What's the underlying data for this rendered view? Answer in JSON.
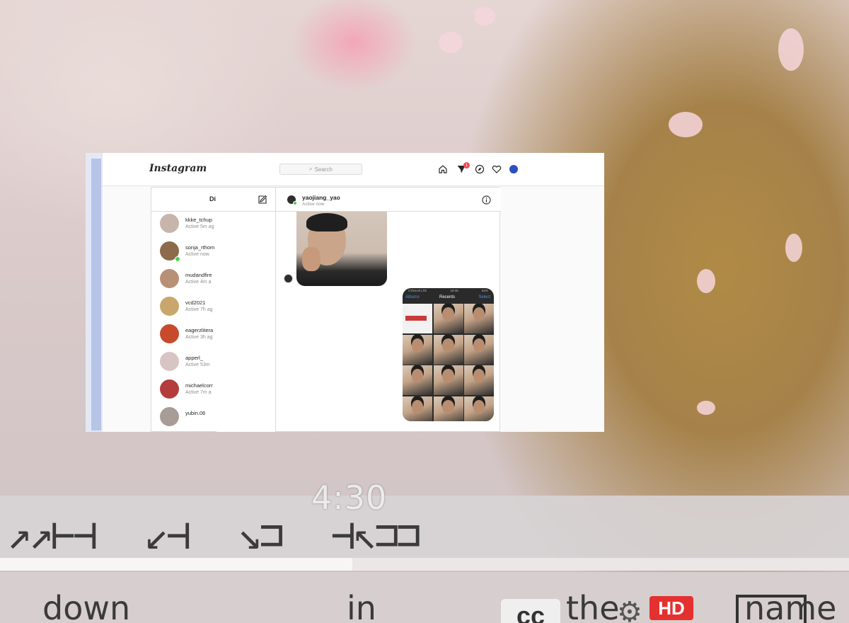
{
  "video": {
    "timestamp": "4:30",
    "progress": 0.415,
    "caption_words": [
      "down",
      "in",
      "the",
      "name"
    ],
    "hd_badge": "HD",
    "cc_label": "cc",
    "colors": {
      "hd_badge": "#e53030",
      "progress_fill": "#f7f5f5"
    }
  },
  "instagram": {
    "logo": "Instagram",
    "search_placeholder": "Search",
    "direct_badge_count": "1",
    "dm_list_title": "Di",
    "conversations": [
      {
        "name": "",
        "status": "Active now",
        "online": true,
        "avatar_color": "#7a4b3a"
      },
      {
        "name": "kkke_tchup",
        "status": "Active 5m ag",
        "online": false,
        "avatar_color": "#c7b5ab"
      },
      {
        "name": "sonja_rthom",
        "status": "Active now",
        "online": true,
        "avatar_color": "#8c6a4a"
      },
      {
        "name": "mudandfire",
        "status": "Active 4m a",
        "online": false,
        "avatar_color": "#b89076"
      },
      {
        "name": "vcd2021",
        "status": "Active 7h ag",
        "online": false,
        "avatar_color": "#c9a66b"
      },
      {
        "name": "eagerzlitera",
        "status": "Active 3h ag",
        "online": false,
        "avatar_color": "#c74a2c"
      },
      {
        "name": "apperl_",
        "status": "Active 53m",
        "online": false,
        "avatar_color": "#d9c4c4"
      },
      {
        "name": "michaelcorr",
        "status": "Active 7m a",
        "online": false,
        "avatar_color": "#b43c3c"
      },
      {
        "name": "yubin.06",
        "status": "",
        "online": false,
        "avatar_color": "#a89c96"
      }
    ],
    "chat": {
      "username": "yaojiang_yao",
      "status": "Active now",
      "sent_screenshot": {
        "carrier": "CTExcel LTE",
        "time": "18:46",
        "battery": "52%",
        "back_label": "Albums",
        "title": "Recents",
        "select_label": "Select",
        "photo_count": 12
      }
    },
    "colors": {
      "notification": "#ed4956",
      "online": "#4fd14f",
      "profile": "#2b4fbf"
    }
  }
}
